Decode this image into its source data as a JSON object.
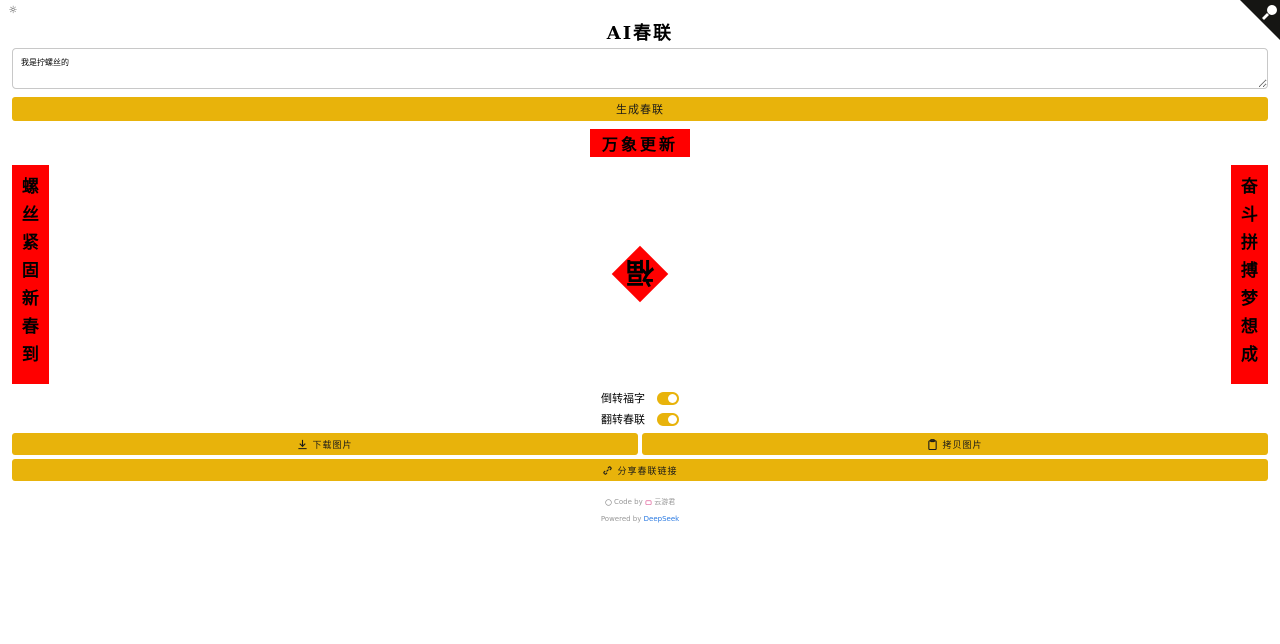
{
  "theme_toggle": {
    "icon": "sun-icon",
    "glyph": "☼"
  },
  "corner": {
    "icon": "github-corner-icon"
  },
  "title": "AI春联",
  "prompt": {
    "value": "我是拧螺丝的"
  },
  "generate_label": "生成春联",
  "couplet": {
    "horizontal": "万象更新",
    "left": [
      "螺",
      "丝",
      "紧",
      "固",
      "新",
      "春",
      "到"
    ],
    "right": [
      "奋",
      "斗",
      "拼",
      "搏",
      "梦",
      "想",
      "成"
    ],
    "fu": "福"
  },
  "toggles": [
    {
      "label": "倒转福字",
      "on": true
    },
    {
      "label": "翻转春联",
      "on": true
    }
  ],
  "actions": {
    "download": "下载图片",
    "copy": "拷贝图片",
    "share": "分享春联链接"
  },
  "footer": {
    "code": "Code",
    "by": "by",
    "author": "云游君",
    "powered_by": "Powered by",
    "deepseek": "DeepSeek"
  },
  "colors": {
    "accent": "#e8b30b",
    "couplet_red": "#ff0000",
    "link": "#2a7ae2"
  }
}
